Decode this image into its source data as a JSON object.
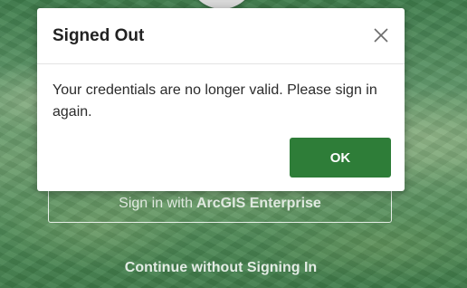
{
  "dialog": {
    "title": "Signed Out",
    "message": "Your credentials are no longer valid. Please sign in again.",
    "ok_label": "OK",
    "close_icon": "close-icon"
  },
  "background": {
    "enterprise_prefix": "Sign in with",
    "enterprise_brand": "ArcGIS Enterprise",
    "continue_label": "Continue without Signing In"
  },
  "colors": {
    "ok_button": "#2e7d38",
    "background_green": "#5d9567"
  }
}
